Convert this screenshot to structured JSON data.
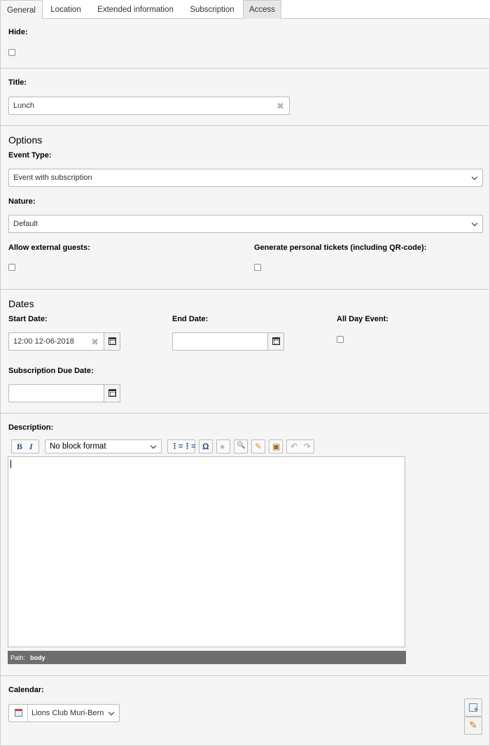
{
  "tabs": [
    {
      "label": "General"
    },
    {
      "label": "Location"
    },
    {
      "label": "Extended information"
    },
    {
      "label": "Subscription"
    },
    {
      "label": "Access"
    }
  ],
  "hide": {
    "label": "Hide:"
  },
  "title_field": {
    "label": "Title:",
    "value": "Lunch"
  },
  "options": {
    "heading": "Options",
    "event_type": {
      "label": "Event Type:",
      "value": "Event with subscription"
    },
    "nature": {
      "label": "Nature:",
      "value": "Default"
    },
    "allow_guests": {
      "label": "Allow external guests:"
    },
    "personal_tickets": {
      "label": "Generate personal tickets (including QR-code):"
    }
  },
  "dates": {
    "heading": "Dates",
    "start": {
      "label": "Start Date:",
      "value": "12:00 12-06-2018"
    },
    "end": {
      "label": "End Date:",
      "value": ""
    },
    "all_day": {
      "label": "All Day Event:"
    },
    "due": {
      "label": "Subscription Due Date:",
      "value": ""
    }
  },
  "description": {
    "label": "Description:",
    "block_format": "No block format",
    "path_label": "Path:",
    "path_value": "body"
  },
  "calendar": {
    "label": "Calendar:",
    "value": "Lions Club Muri-Bern"
  },
  "icons": {
    "bold": "bold-icon",
    "italic": "italic-icon",
    "ordered_list": "ordered-list-icon",
    "unordered_list": "unordered-list-icon",
    "special_char": "omega-icon",
    "link": "link-icon",
    "find": "binoculars-icon",
    "clean": "broom-icon",
    "paste": "paste-icon",
    "undo": "undo-icon",
    "redo": "redo-icon"
  }
}
